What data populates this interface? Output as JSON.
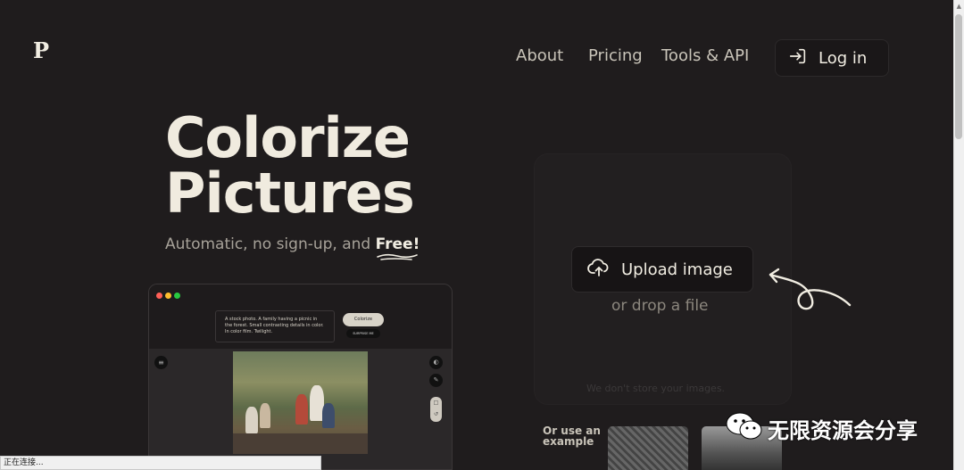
{
  "brand": {
    "logo_letter": "P"
  },
  "nav": {
    "about": "About",
    "pricing": "Pricing",
    "tools": "Tools & API",
    "login": "Log in"
  },
  "hero": {
    "title_line1": "Colorize",
    "title_line2": "Pictures",
    "subtitle_prefix": "Automatic, no sign-up, and ",
    "subtitle_free": "Free!"
  },
  "mockup": {
    "prompt": "A stock photo. A family having a picnic in the forest. Small contrasting details in color. In color film. Twilight.",
    "colorize_button": "Colorize",
    "surprise_button": "SURPRISE ME"
  },
  "upload": {
    "button_label": "Upload image",
    "drop_hint": "or drop a file",
    "privacy_note": "We don't store your images."
  },
  "examples": {
    "label_line1": "Or use an",
    "label_line2": "example"
  },
  "watermark": {
    "text": "无限资源会分享"
  },
  "status_bar": {
    "text": "正在连接..."
  },
  "colors": {
    "background": "#1f1c1d",
    "text": "#f0ebdf",
    "muted": "#a7a299"
  }
}
